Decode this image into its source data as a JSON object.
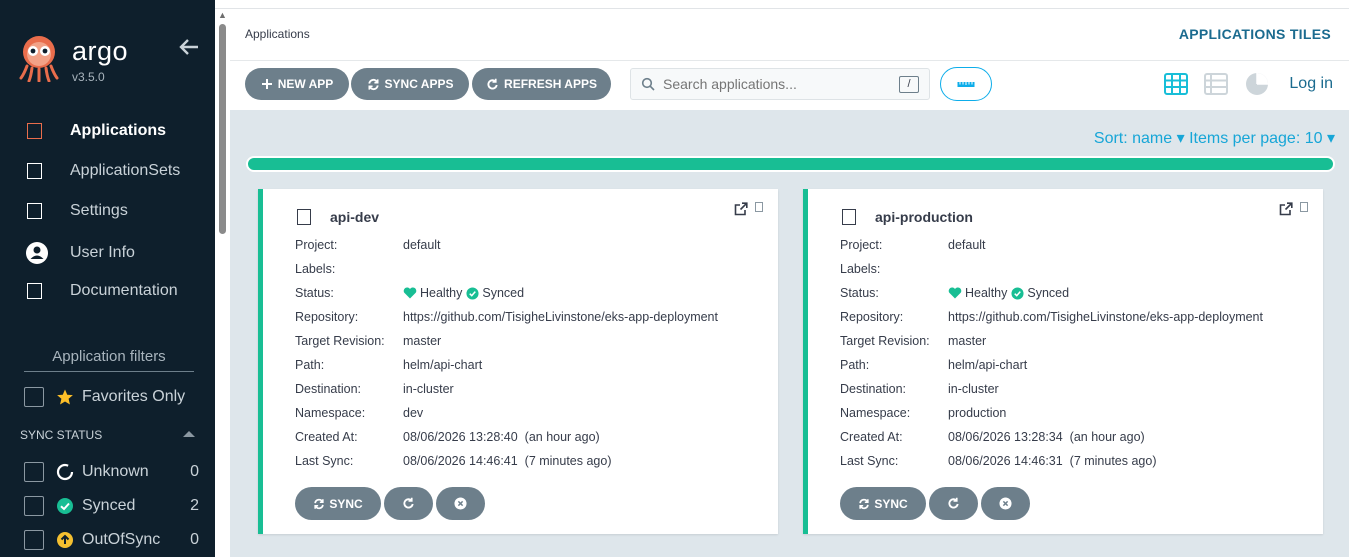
{
  "sidebar": {
    "brand": "argo",
    "version": "v3.5.0",
    "nav": [
      {
        "label": "Applications",
        "active": true
      },
      {
        "label": "ApplicationSets"
      },
      {
        "label": "Settings"
      },
      {
        "label": "User Info"
      },
      {
        "label": "Documentation"
      }
    ],
    "filters_title": "Application filters",
    "favorites_label": "Favorites Only",
    "sync_status_label": "SYNC STATUS",
    "sync_filters": [
      {
        "label": "Unknown",
        "count": "0"
      },
      {
        "label": "Synced",
        "count": "2"
      },
      {
        "label": "OutOfSync",
        "count": "0"
      }
    ]
  },
  "header": {
    "title": "Applications",
    "view_title": "APPLICATIONS TILES",
    "login": "Log in"
  },
  "toolbar": {
    "new_app": "NEW APP",
    "sync_apps": "SYNC APPS",
    "refresh_apps": "REFRESH APPS",
    "search_placeholder": "Search applications...",
    "search_shortcut": "/"
  },
  "listing": {
    "sort": "Sort: name",
    "items_per_page": "Items per page: 10"
  },
  "labels": {
    "project": "Project:",
    "labels": "Labels:",
    "status": "Status:",
    "repository": "Repository:",
    "target_revision": "Target Revision:",
    "path": "Path:",
    "destination": "Destination:",
    "namespace": "Namespace:",
    "created_at": "Created At:",
    "last_sync": "Last Sync:",
    "sync_button": "SYNC"
  },
  "apps": [
    {
      "name": "api-dev",
      "project": "default",
      "labels": "",
      "health": "Healthy",
      "sync": "Synced",
      "repository": "https://github.com/TisigheLivinstone/eks-app-deployment",
      "target_revision": "master",
      "path": "helm/api-chart",
      "destination": "in-cluster",
      "namespace": "dev",
      "created_at": "08/06/2026 13:28:40",
      "created_ago": "(an hour ago)",
      "last_sync": "08/06/2026 14:46:41",
      "last_sync_ago": "(7 minutes ago)"
    },
    {
      "name": "api-production",
      "project": "default",
      "labels": "",
      "health": "Healthy",
      "sync": "Synced",
      "repository": "https://github.com/TisigheLivinstone/eks-app-deployment",
      "target_revision": "master",
      "path": "helm/api-chart",
      "destination": "in-cluster",
      "namespace": "production",
      "created_at": "08/06/2026 13:28:34",
      "created_ago": "(an hour ago)",
      "last_sync": "08/06/2026 14:46:31",
      "last_sync_ago": "(7 minutes ago)"
    }
  ],
  "colors": {
    "sidebar_bg": "#0e1f2c",
    "accent_teal": "#18be94",
    "link_blue": "#17a6d7",
    "button_gray": "#6d7f8b",
    "content_bg": "#dee6eb"
  }
}
